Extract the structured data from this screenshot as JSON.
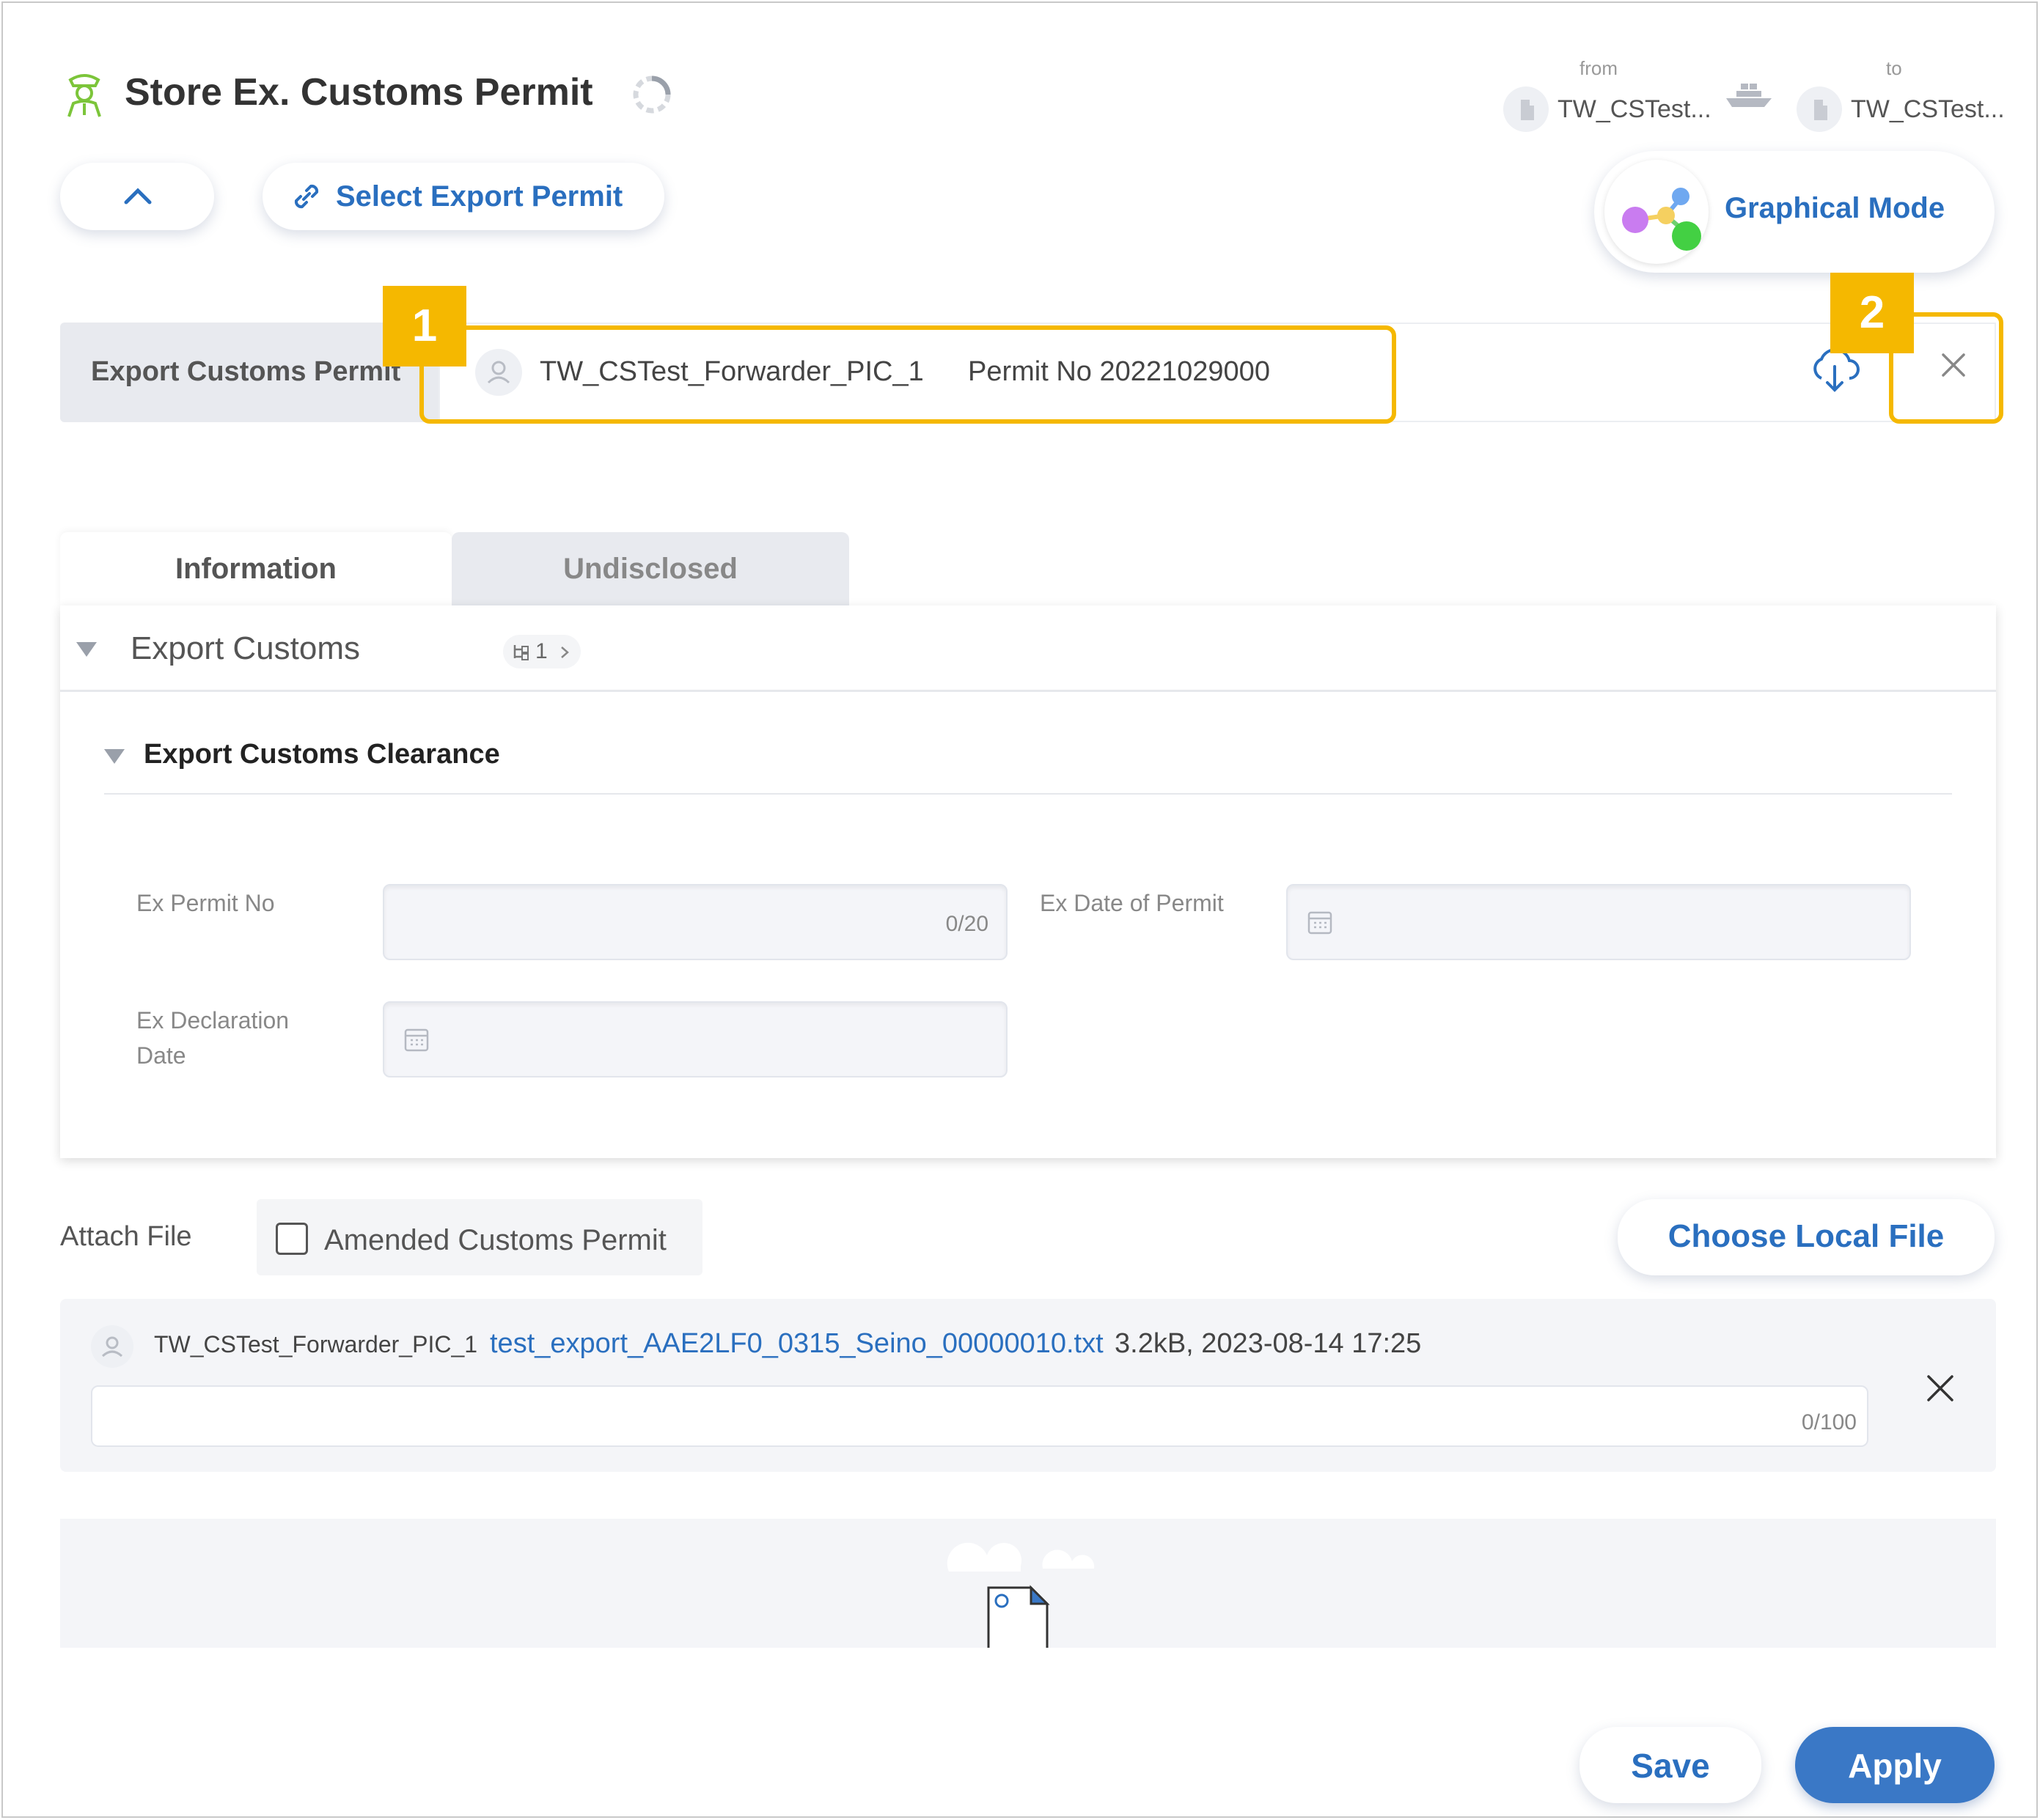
{
  "header": {
    "title": "Store Ex. Customs Permit",
    "title_icon": "customs-officer-icon",
    "from_label": "from",
    "from_name": "TW_CSTest...",
    "to_label": "to",
    "to_name": "TW_CSTest...",
    "transport_icon": "ship-icon"
  },
  "toolbar": {
    "collapse_icon": "chevron-up-icon",
    "select_permit_label": "Select Export Permit",
    "graphical_mode_label": "Graphical Mode"
  },
  "permit": {
    "label": "Export Customs Permit",
    "user": "TW_CSTest_Forwarder_PIC_1",
    "permit_no": "Permit No 20221029000"
  },
  "callouts": {
    "badge1": "1",
    "badge2": "2"
  },
  "tabs": [
    {
      "label": "Information",
      "active": true
    },
    {
      "label": "Undisclosed",
      "active": false
    }
  ],
  "section": {
    "title": "Export Customs",
    "tree_count": "1",
    "subsection_title": "Export Customs Clearance",
    "fields": {
      "ex_permit_no": {
        "label": "Ex Permit No",
        "value": "",
        "counter": "0/20"
      },
      "ex_date_of_permit": {
        "label": "Ex Date of Permit",
        "value": ""
      },
      "ex_declaration_date": {
        "label_line1": "Ex Declaration",
        "label_line2": "Date",
        "value": ""
      }
    }
  },
  "attach": {
    "label": "Attach File",
    "amended_label": "Amended Customs Permit",
    "amended_checked": false,
    "choose_label": "Choose Local File",
    "file": {
      "user": "TW_CSTest_Forwarder_PIC_1",
      "name": "test_export_AAE2LF0_0315_Seino_00000010.txt",
      "meta": "3.2kB, 2023-08-14 17:25",
      "memo_counter": "0/100"
    }
  },
  "footer": {
    "save_label": "Save",
    "apply_label": "Apply"
  },
  "colors": {
    "accent": "#2a6fbf",
    "apply": "#3a78c6",
    "highlight": "#f5b800"
  }
}
